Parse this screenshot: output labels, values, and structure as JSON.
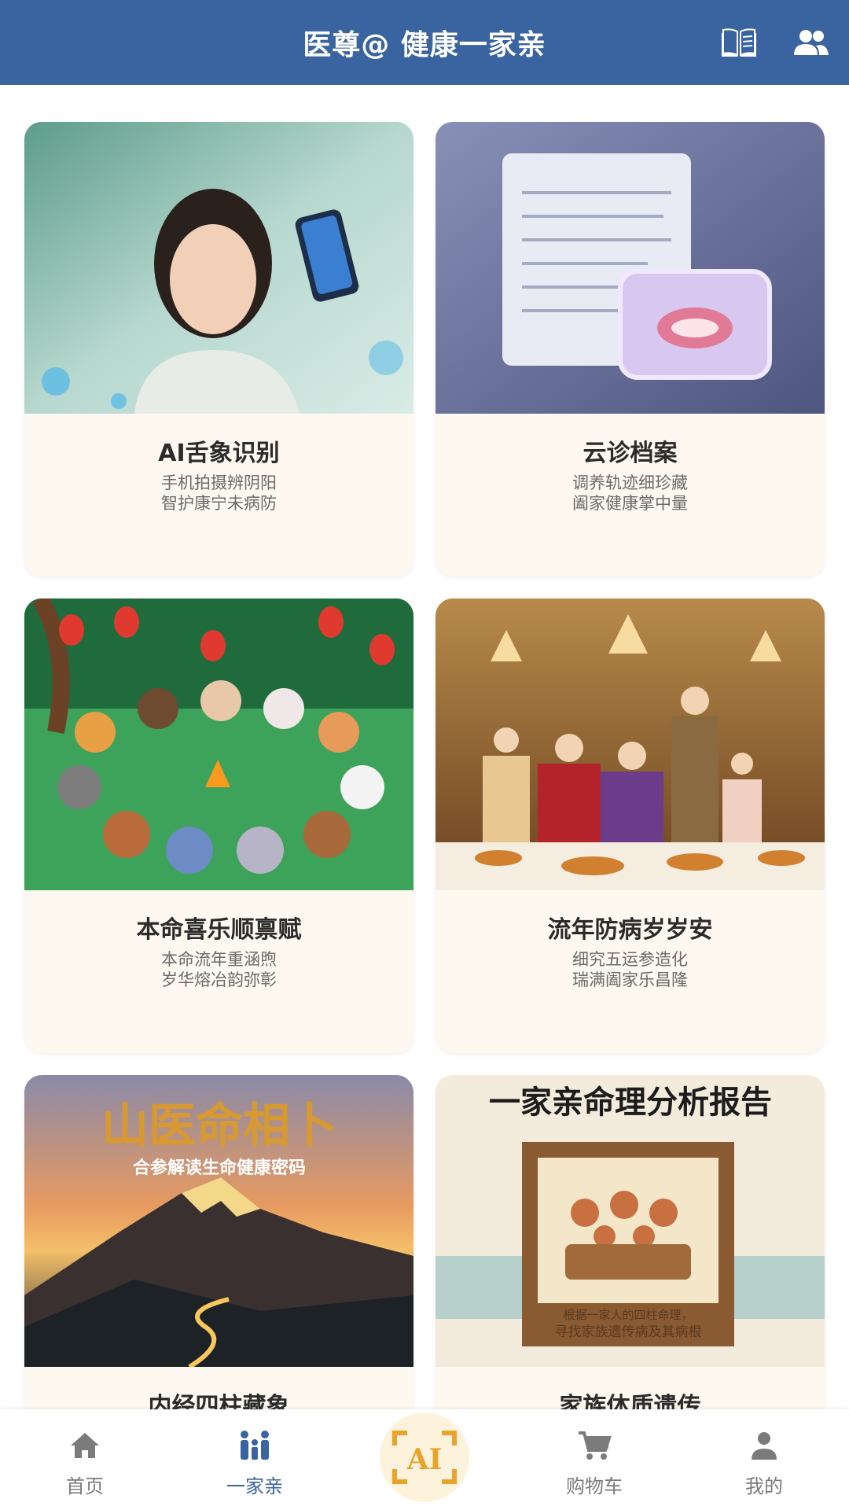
{
  "header": {
    "title": "医尊@ 健康一家亲"
  },
  "cards": [
    {
      "title": "AI舌象识别",
      "line1": "手机拍摄辨阴阳",
      "line2": "智护康宁未病防"
    },
    {
      "title": "云诊档案",
      "line1": "调养轨迹细珍藏",
      "line2": "阖家健康掌中量"
    },
    {
      "title": "本命喜乐顺禀赋",
      "line1": "本命流年重涵煦",
      "line2": "岁华熔冶韵弥彰"
    },
    {
      "title": "流年防病岁岁安",
      "line1": "细究五运参造化",
      "line2": "瑞满阖家乐昌隆"
    },
    {
      "title": "内经四柱藏象",
      "line1": "",
      "line2": "",
      "image_title": "山医命相卜",
      "image_subtitle": "合参解读生命健康密码"
    },
    {
      "title": "家族体质遗传",
      "line1": "",
      "line2": "",
      "image_title": "一家亲命理分析报告",
      "image_caption1": "根据一家人的四柱命理，",
      "image_caption2": "寻找家族遗传病及其病根"
    }
  ],
  "tabs": [
    {
      "label": "首页",
      "icon": "home-icon"
    },
    {
      "label": "一家亲",
      "icon": "family-icon",
      "active": true
    },
    {
      "label": "AI",
      "icon": "ai-scan-icon"
    },
    {
      "label": "购物车",
      "icon": "cart-icon"
    },
    {
      "label": "我的",
      "icon": "person-icon"
    }
  ],
  "colors": {
    "header": "#3a64a0",
    "card_bg": "#fdf9f0",
    "ai_accent": "#e8a32b",
    "active_tab": "#3a64a0"
  }
}
